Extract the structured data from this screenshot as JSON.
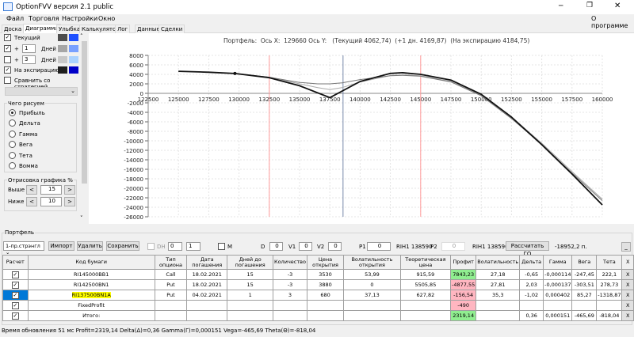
{
  "window": {
    "title": "OptionFVV версия 2.1 public",
    "about": "О программе"
  },
  "menu": [
    "Файл",
    "Торговля",
    "Настройки",
    "Окно"
  ],
  "tabs": [
    "Доска",
    "Диаграмма",
    "Улыбка",
    "Калькулятор",
    "Лог",
    "Данные",
    "Сделки"
  ],
  "left": {
    "current": {
      "label": "Текущий",
      "checked": true,
      "colors": [
        "#4d4d4d",
        "#1e50ff"
      ]
    },
    "plus1": {
      "sign": "+",
      "value": "1",
      "unit": "Дней",
      "checked": true,
      "colors": [
        "#a6a6a6",
        "#78a0ff"
      ]
    },
    "plus3": {
      "sign": "+",
      "value": "3",
      "unit": "Дней",
      "checked": false,
      "colors": [
        "#c8c8c8",
        "#aad2ff"
      ]
    },
    "expiry": {
      "label": "На экспирацию",
      "checked": true,
      "colors": [
        "#1e1e1e",
        "#0000c8"
      ]
    },
    "compare": {
      "label": "Сравнить со стратегией",
      "checked": false
    },
    "what_title": "Чего рисуем",
    "what_options": [
      "Прибыль",
      "Дельта",
      "Гамма",
      "Вега",
      "Тета",
      "Вомма"
    ],
    "what_selected": 0,
    "range_title": "Отрисовка графика %",
    "above_label": "Выше",
    "above_value": "15",
    "below_label": "Ниже",
    "below_value": "10",
    "prev": "<",
    "next": ">"
  },
  "chart_data": {
    "type": "line",
    "title": "Портфель:  Ось X:  129660 Ось Y:   (Текущий 4062,74)  (+1 дн. 4169,87)  (На экспирацию 4184,75)",
    "xlim": [
      122500,
      160000
    ],
    "ylim": [
      -26000,
      8000
    ],
    "xticks": [
      122500,
      125000,
      127500,
      130000,
      132500,
      135000,
      137500,
      140000,
      142500,
      145000,
      147500,
      150000,
      152500,
      155000,
      157500,
      160000
    ],
    "yticks": [
      8000,
      6000,
      4000,
      2000,
      0,
      -2000,
      -4000,
      -6000,
      -8000,
      -10000,
      -12000,
      -14000,
      -16000,
      -18000,
      -20000,
      -22000,
      -24000,
      -26000
    ],
    "grid": true,
    "vlines": [
      {
        "x": 132500,
        "color": "#ff9999"
      },
      {
        "x": 145000,
        "color": "#ff9999"
      },
      {
        "x": 138590,
        "color": "#7788aa"
      }
    ],
    "marker": {
      "x": 129660,
      "y": 4184.75
    },
    "series": [
      {
        "color": "#aaaaaa",
        "x": [
          125000,
          127500,
          130000,
          132500,
          135000,
          136500,
          137500,
          138500,
          140000,
          142500,
          143500,
          145000,
          147500,
          150000,
          152500,
          155000,
          157500,
          160000
        ],
        "y": [
          4650,
          4450,
          4100,
          3400,
          2000,
          1200,
          800,
          1200,
          2400,
          3750,
          3900,
          3700,
          2500,
          -300,
          -5000,
          -10500,
          -16500,
          -22300
        ]
      },
      {
        "color": "#777777",
        "x": [
          125000,
          127500,
          130000,
          132500,
          135000,
          136500,
          137500,
          138500,
          140000,
          142500,
          143500,
          145000,
          147500,
          150000,
          152500,
          155000,
          157500,
          160000
        ],
        "y": [
          4650,
          4450,
          4080,
          3400,
          2300,
          2000,
          2000,
          2200,
          2900,
          3700,
          3800,
          3600,
          2400,
          -500,
          -5300,
          -10800,
          -16800,
          -22600
        ]
      },
      {
        "color": "#111111",
        "x": [
          125000,
          127500,
          129660,
          132500,
          135000,
          137500,
          140000,
          142500,
          143500,
          145000,
          147500,
          150000,
          152500,
          155000,
          157500,
          160000
        ],
        "y": [
          4650,
          4450,
          4185,
          3300,
          1600,
          -900,
          2500,
          4200,
          4350,
          4000,
          2800,
          -200,
          -5000,
          -10800,
          -17000,
          -23500
        ]
      }
    ]
  },
  "portfolio": {
    "title": "Портфель",
    "strategy": "1-пр.стрэнгл",
    "import": "Импорт",
    "delete": "Удалить",
    "save": "Сохранить",
    "dh_label": "DH",
    "spin1": "0",
    "spin2": "1",
    "m_label": "M",
    "d_label": "D",
    "d_value": "0",
    "v1_label": "V1",
    "v1_value": "0",
    "v2_label": "V2",
    "v2_value": "0",
    "p1_label": "P1",
    "p1_value": "0",
    "p1_info": "RIH1 138590",
    "p2_label": "P2",
    "p2_value": "0",
    "p2_info": "RIH1 138590",
    "calc_go": "Рассчитать ГО",
    "go_value": "-18952,2 п.",
    "minimize": "_",
    "columns": [
      "Расчет",
      "Код бумаги",
      "Тип опциона",
      "Дата погашения",
      "Дней до погашения",
      "Количество",
      "Цена открытия",
      "Волатильность открытия",
      "Теоретическая цена",
      "Профит",
      "Волатильность",
      "Дельта",
      "Гамма",
      "Вега",
      "Тета",
      "X"
    ],
    "rows": [
      {
        "code": "RI145000BB1",
        "type": "Call",
        "date": "18.02.2021",
        "days": "15",
        "qty": "-3",
        "price": "3530",
        "vol_open": "53,99",
        "theo": "915,59",
        "profit": "7843,23",
        "profit_state": "green",
        "vol": "27,18",
        "delta": "-0,65",
        "gamma": "-0,000114",
        "vega": "-247,45",
        "theta": "222,1"
      },
      {
        "code": "RI142500BN1",
        "type": "Put",
        "date": "18.02.2021",
        "days": "15",
        "qty": "-3",
        "price": "3880",
        "vol_open": "0",
        "theo": "5505,85",
        "profit": "-4877,55",
        "profit_state": "red",
        "vol": "27,81",
        "delta": "2,03",
        "gamma": "-0,000137",
        "vega": "-303,51",
        "theta": "278,73"
      },
      {
        "code": "RI137500BN1A",
        "type": "Put",
        "date": "04.02.2021",
        "days": "1",
        "qty": "3",
        "price": "680",
        "vol_open": "37,13",
        "theo": "627,82",
        "profit": "-156,54",
        "profit_state": "red",
        "vol": "35,3",
        "delta": "-1,02",
        "gamma": "0,000402",
        "vega": "85,27",
        "theta": "-1318,87"
      },
      {
        "code": "FixedProfit",
        "type": "",
        "date": "",
        "days": "",
        "qty": "",
        "price": "",
        "vol_open": "",
        "theo": "",
        "profit": "-490",
        "profit_state": "red",
        "vol": "",
        "delta": "",
        "gamma": "",
        "vega": "",
        "theta": ""
      },
      {
        "code": "Итого:",
        "type": "",
        "date": "",
        "days": "",
        "qty": "",
        "price": "",
        "vol_open": "",
        "theo": "",
        "profit": "2319,14",
        "profit_state": "green",
        "vol": "",
        "delta": "0,36",
        "gamma": "0,000151",
        "vega": "-465,69",
        "theta": "-818,04"
      }
    ],
    "remove": "X"
  },
  "status": "Время обновления 51 мс  Profit=2319,14 Delta(Δ)=0,36 Gamma(Γ)=0,000151 Vega=-465,69 Theta(Θ)=-818,04"
}
